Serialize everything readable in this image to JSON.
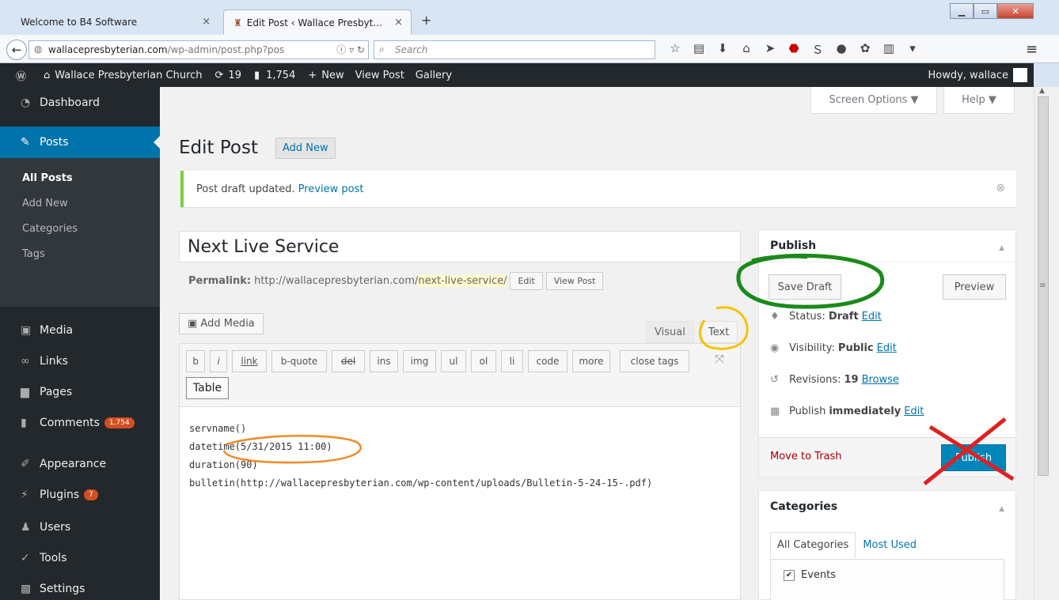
{
  "browser": {
    "tabs": [
      {
        "label": "Welcome to B4 Software",
        "active": false
      },
      {
        "label": "Edit Post ‹ Wallace Presbyt...",
        "active": true
      }
    ],
    "url_host": "wallacepresbyterian.com",
    "url_path": "/wp-admin/post.php?pos",
    "search_placeholder": "Search"
  },
  "adminbar": {
    "site": "Wallace Presbyterian Church",
    "updates": "19",
    "comments": "1,754",
    "new": "New",
    "view_post": "View Post",
    "gallery": "Gallery",
    "howdy": "Howdy, wallace"
  },
  "sidebar": {
    "items": [
      {
        "label": "Dashboard",
        "icon": "dashboard-icon"
      },
      {
        "label": "Posts",
        "icon": "pin-icon"
      },
      {
        "label": "Media",
        "icon": "media-icon"
      },
      {
        "label": "Links",
        "icon": "link-icon"
      },
      {
        "label": "Pages",
        "icon": "pages-icon"
      },
      {
        "label": "Comments",
        "icon": "comment-icon",
        "badge": "1,754"
      },
      {
        "label": "Appearance",
        "icon": "brush-icon"
      },
      {
        "label": "Plugins",
        "icon": "plug-icon",
        "badge": "7"
      },
      {
        "label": "Users",
        "icon": "users-icon"
      },
      {
        "label": "Tools",
        "icon": "wrench-icon"
      },
      {
        "label": "Settings",
        "icon": "settings-icon"
      }
    ],
    "sub": [
      "All Posts",
      "Add New",
      "Categories",
      "Tags"
    ]
  },
  "screen": {
    "screen_options": "Screen Options ▼",
    "help": "Help ▼"
  },
  "page": {
    "title": "Edit Post",
    "add_new": "Add New"
  },
  "notice": {
    "text": "Post draft updated.",
    "link": "Preview post"
  },
  "post": {
    "title": "Next Live Service",
    "permalink_label": "Permalink:",
    "permalink_base": "http://wallacepresbyterian.com/",
    "permalink_slug": "next-live-service/",
    "edit": "Edit",
    "view_post": "View Post",
    "add_media": "Add Media",
    "visual": "Visual",
    "text": "Text",
    "quicktags": [
      "b",
      "i",
      "link",
      "b-quote",
      "del",
      "ins",
      "img",
      "ul",
      "ol",
      "li",
      "code",
      "more",
      "close tags"
    ],
    "table": "Table",
    "content": "servname()\ndatetime(5/31/2015 11:00)\nduration(90)\nbulletin(http://wallacepresbyterian.com/wp-content/uploads/Bulletin-5-24-15-.pdf)"
  },
  "publish": {
    "title": "Publish",
    "save_draft": "Save Draft",
    "preview": "Preview",
    "status_label": "Status:",
    "status_value": "Draft",
    "edit": "Edit",
    "visibility_label": "Visibility:",
    "visibility_value": "Public",
    "revisions_label": "Revisions:",
    "revisions_value": "19",
    "browse": "Browse",
    "publish_label": "Publish",
    "publish_value": "immediately",
    "trash": "Move to Trash",
    "publish_btn": "Publish"
  },
  "categories": {
    "title": "Categories",
    "tab_all": "All Categories",
    "tab_used": "Most Used",
    "items": [
      {
        "label": "Events",
        "checked": true
      }
    ]
  },
  "colors": {
    "admin_bg": "#23282d",
    "accent": "#0073aa",
    "notice_green": "#7ad03a",
    "green_annot": "#1a8a1a",
    "yellow_annot": "#f2c400",
    "orange_annot": "#f08a24",
    "red_annot": "#e02020"
  }
}
